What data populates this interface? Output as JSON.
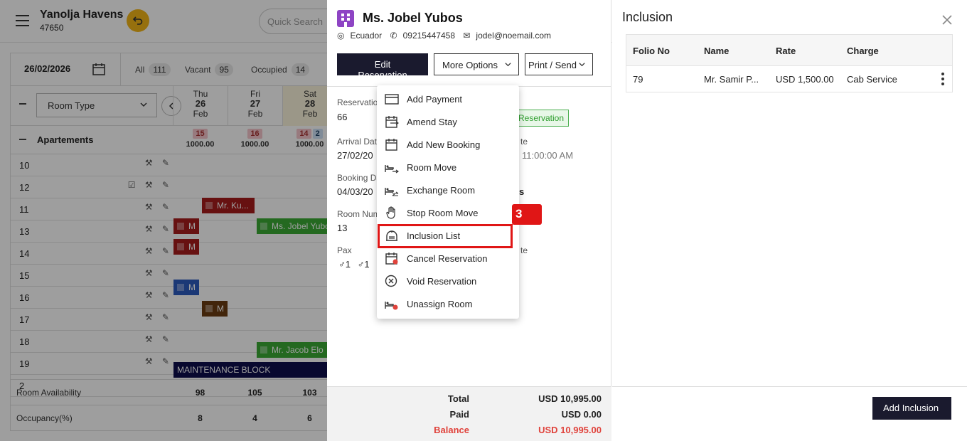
{
  "app": {
    "hotel_name": "Yanolja Havens",
    "hotel_id": "47650",
    "search_placeholder": "Quick Search"
  },
  "grid": {
    "date": "26/02/2026",
    "filters": [
      {
        "label": "All",
        "count": "111"
      },
      {
        "label": "Vacant",
        "count": "95"
      },
      {
        "label": "Occupied",
        "count": "14"
      }
    ],
    "room_type_select": "Room Type",
    "days": [
      {
        "dow": "Thu",
        "day": "26",
        "month": "Feb"
      },
      {
        "dow": "Fri",
        "day": "27",
        "month": "Feb"
      },
      {
        "dow": "Sat",
        "day": "28",
        "month": "Feb"
      }
    ],
    "group": "Apartements",
    "group_rates": [
      {
        "pills": [
          "15"
        ],
        "rate": "1000.00"
      },
      {
        "pills": [
          "16"
        ],
        "rate": "1000.00"
      },
      {
        "pills": [
          "14",
          "2"
        ],
        "rate": "1000.00"
      }
    ],
    "rooms": [
      "10",
      "12",
      "11",
      "13",
      "14",
      "15",
      "16",
      "17",
      "18",
      "19",
      "2"
    ],
    "bookings": {
      "b1": "Mr. Ku...",
      "b2": "M",
      "b3": "Ms. Jobel Yubos",
      "b4": "M",
      "b5": "M",
      "b6": "M",
      "b7": "Mr. Jacob Elo",
      "maint": "MAINTENANCE BLOCK"
    },
    "footer": {
      "availability_label": "Room Availability",
      "availability": [
        "98",
        "105",
        "103"
      ],
      "occupancy_label": "Occupancy(%)",
      "occupancy": [
        "8",
        "4",
        "6"
      ]
    }
  },
  "reservation": {
    "guest_name": "Ms. Jobel Yubos",
    "country": "Ecuador",
    "phone": "09215447458",
    "email": "jodel@noemail.com",
    "edit_label": "Edit Reservation",
    "more_label": "More Options",
    "print_label": "Print / Send",
    "reservation_label": "Reservatio",
    "reservation_value": "66",
    "badge": "Reservation",
    "arrival_label": "Arrival Dat",
    "arrival_value": "27/02/20",
    "departure_label": "te",
    "departure_time": "11:00:00 AM",
    "booking_label": "Booking Da",
    "booking_value": "04/03/20",
    "booking_extra": "s",
    "room_label": "Room Num",
    "room_value": "13",
    "pax_label": "Pax",
    "pax_adults": "1",
    "pax_children": "1",
    "pax_extra": "te",
    "totals": {
      "total_label": "Total",
      "total_value": "USD 10,995.00",
      "paid_label": "Paid",
      "paid_value": "USD 0.00",
      "balance_label": "Balance",
      "balance_value": "USD 10,995.00"
    }
  },
  "menu": {
    "items": [
      {
        "label": "Add Payment",
        "icon": "card-icon"
      },
      {
        "label": "Amend Stay",
        "icon": "calendar-amend-icon"
      },
      {
        "label": "Add New Booking",
        "icon": "calendar-icon"
      },
      {
        "label": "Room Move",
        "icon": "bed-move-icon"
      },
      {
        "label": "Exchange Room",
        "icon": "bed-exchange-icon"
      },
      {
        "label": "Stop Room Move",
        "icon": "hand-icon"
      },
      {
        "label": "Inclusion List",
        "icon": "inclusion-icon"
      },
      {
        "label": "Cancel Reservation",
        "icon": "calendar-cancel-icon"
      },
      {
        "label": "Void Reservation",
        "icon": "circle-x-icon"
      },
      {
        "label": "Unassign Room",
        "icon": "bed-unassign-icon"
      }
    ],
    "step_badge": "3"
  },
  "inclusion": {
    "title": "Inclusion",
    "columns": [
      "Folio No",
      "Name",
      "Rate",
      "Charge"
    ],
    "rows": [
      {
        "folio": "79",
        "name": "Mr. Samir P...",
        "rate": "USD 1,500.00",
        "charge": "Cab Service"
      }
    ],
    "add_label": "Add Inclusion"
  },
  "colors": {
    "primary_dark": "#1a1a2e",
    "highlight_red": "#e01616",
    "balance_red": "#e0433c",
    "guest_purple": "#8e44c4",
    "accent_yellow": "#f2b518"
  }
}
